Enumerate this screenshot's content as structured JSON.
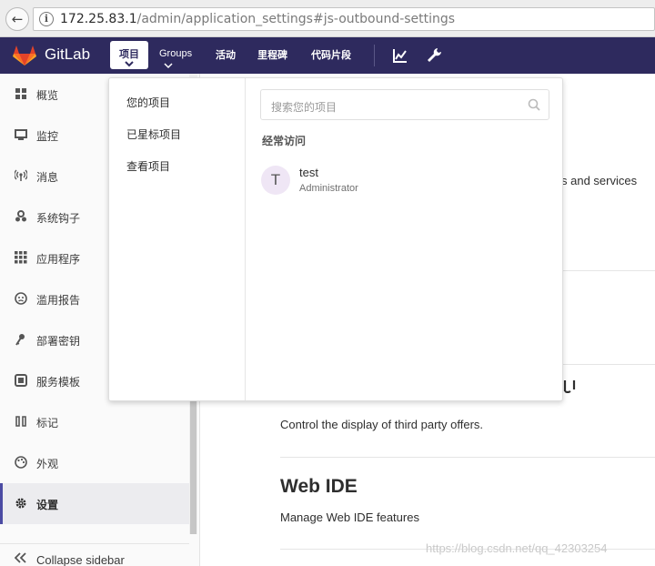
{
  "browser": {
    "url_host": "172.25.83.1",
    "url_path": "/admin/application_settings#js-outbound-settings",
    "info_glyph": "i",
    "back_glyph": "←"
  },
  "navbar": {
    "brand": "GitLab",
    "projects_label": "项目",
    "groups_label": "Groups",
    "activity_label": "活动",
    "milestones_label": "里程碑",
    "snippets_label": "代码片段",
    "bg_color": "#2e2a5e"
  },
  "sidebar": {
    "items": [
      {
        "label": "概览",
        "icon": "grid-icon"
      },
      {
        "label": "监控",
        "icon": "monitor-icon"
      },
      {
        "label": "消息",
        "icon": "broadcast-icon"
      },
      {
        "label": "系统钩子",
        "icon": "hook-icon"
      },
      {
        "label": "应用程序",
        "icon": "apps-icon"
      },
      {
        "label": "滥用报告",
        "icon": "face-icon"
      },
      {
        "label": "部署密钥",
        "icon": "key-icon"
      },
      {
        "label": "服务模板",
        "icon": "template-icon"
      },
      {
        "label": "标记",
        "icon": "label-icon"
      },
      {
        "label": "外观",
        "icon": "palette-icon"
      },
      {
        "label": "设置",
        "icon": "gear-icon"
      }
    ],
    "active_index": 10,
    "collapse_label": "Collapse sidebar"
  },
  "main": {
    "partial_text": "s and services",
    "third_party_desc": "Control the display of third party offers.",
    "web_ide_title": "Web IDE",
    "web_ide_desc": "Manage Web IDE features",
    "watermark": "https://blog.csdn.net/qq_42303254"
  },
  "projects_dropdown": {
    "links": [
      "您的项目",
      "已星标项目",
      "查看项目"
    ],
    "search_placeholder": "搜索您的项目",
    "frequent_header": "经常访问",
    "frequent": [
      {
        "avatar_letter": "T",
        "name": "test",
        "namespace": "Administrator"
      }
    ]
  }
}
